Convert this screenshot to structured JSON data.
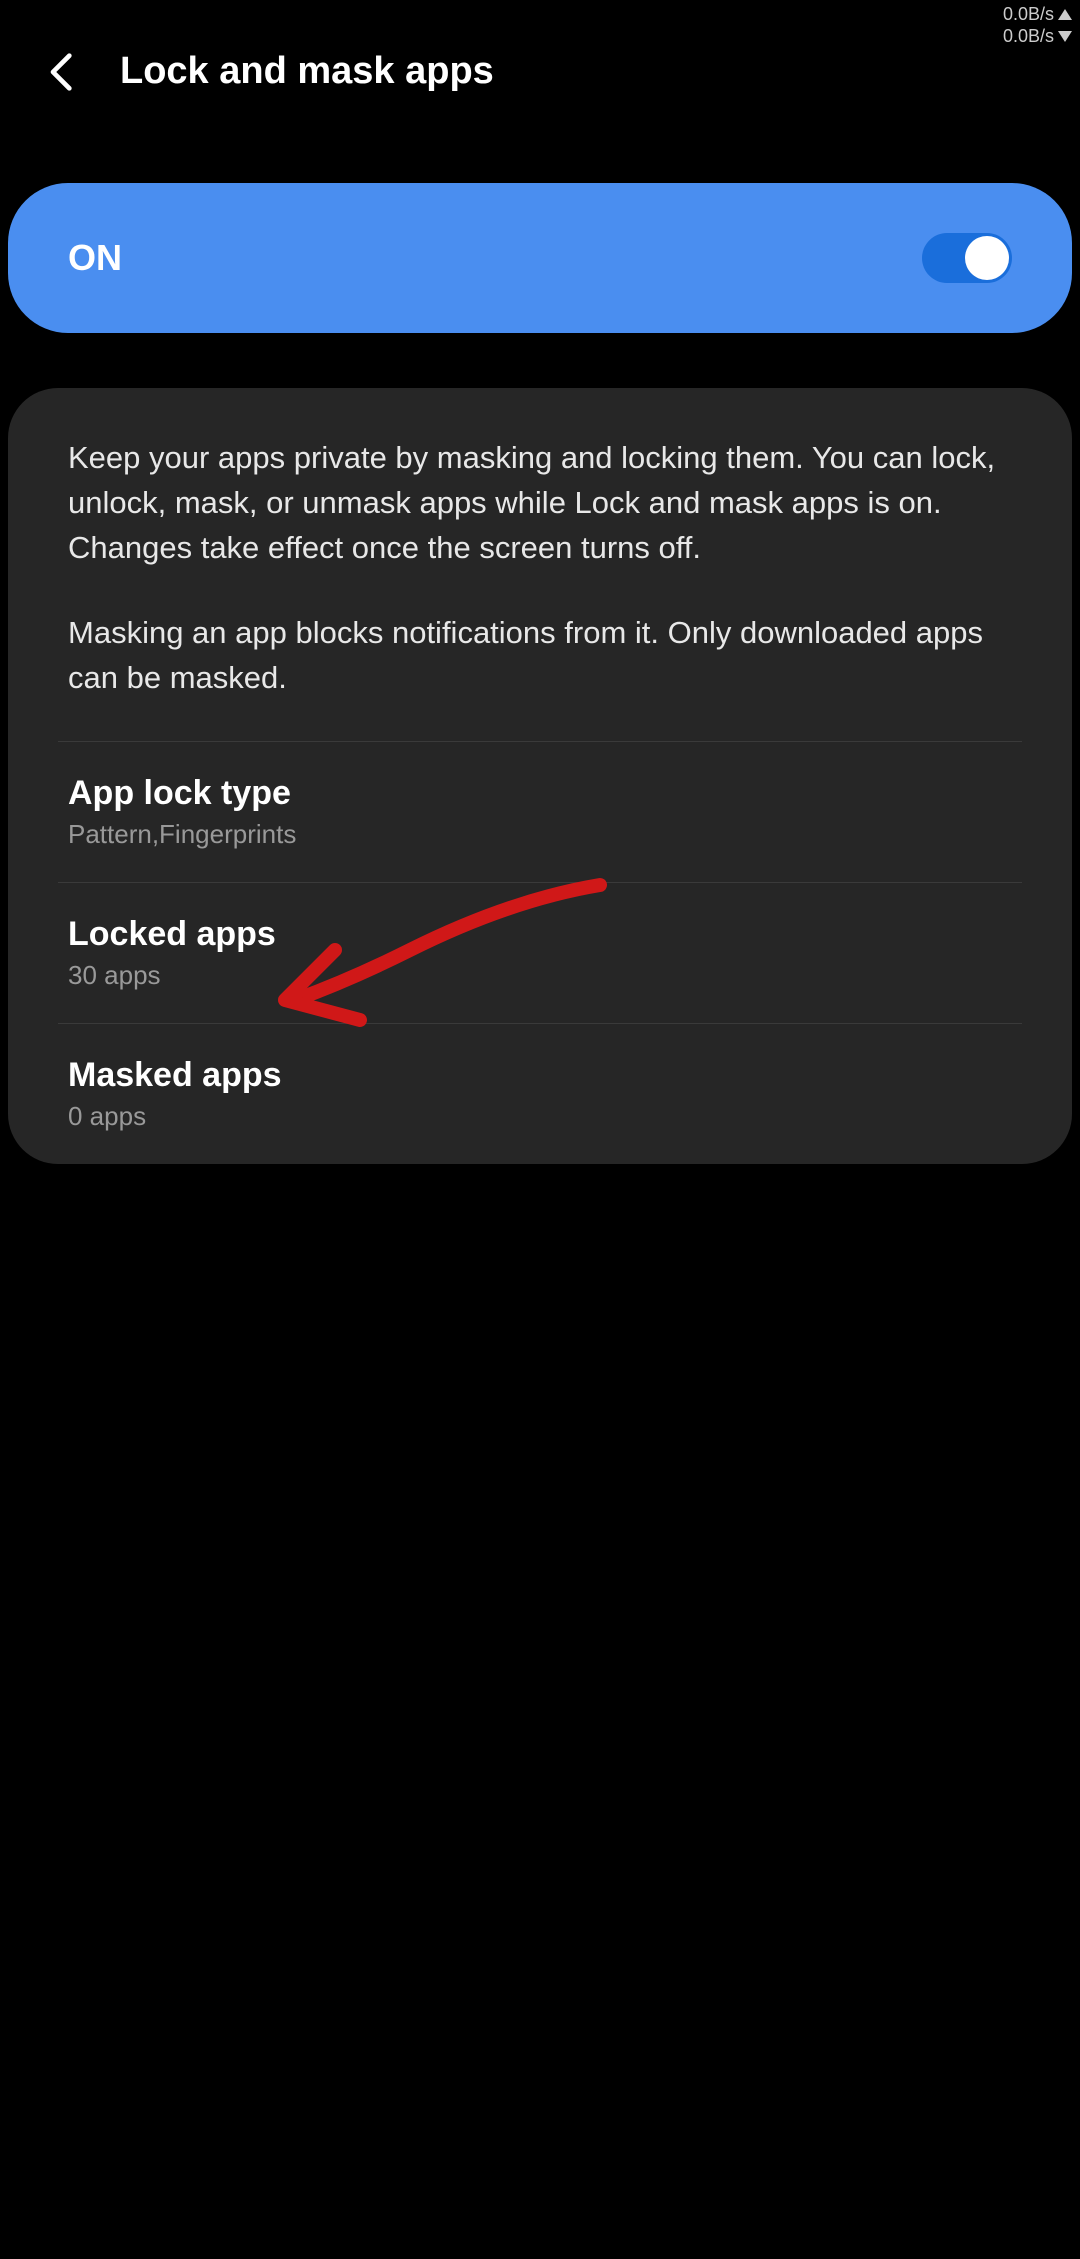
{
  "status": {
    "upload_speed": "0.0B/s",
    "download_speed": "0.0B/s"
  },
  "header": {
    "title": "Lock and mask apps"
  },
  "toggle": {
    "label": "ON",
    "state": true
  },
  "description": {
    "paragraph1": "Keep your apps private by masking and locking them. You can lock, unlock, mask, or unmask apps while Lock and mask apps is on. Changes take effect once the screen turns off.",
    "paragraph2": "Masking an app blocks notifications from it. Only downloaded apps can be masked."
  },
  "settings": [
    {
      "title": "App lock type",
      "subtitle": "Pattern,Fingerprints"
    },
    {
      "title": "Locked apps",
      "subtitle": "30 apps"
    },
    {
      "title": "Masked apps",
      "subtitle": "0 apps"
    }
  ]
}
